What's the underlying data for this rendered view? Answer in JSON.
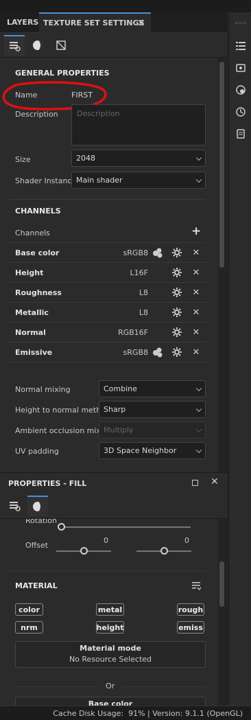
{
  "tabs": {
    "layers": "LAYERS",
    "texture_set_settings": "TEXTURE SET SETTINGS"
  },
  "general": {
    "title": "GENERAL PROPERTIES",
    "name_label": "Name",
    "name_value": "FIRST",
    "description_label": "Description",
    "description_placeholder": "Description",
    "size_label": "Size",
    "size_value": "2048",
    "shader_label": "Shader Instance",
    "shader_value": "Main shader"
  },
  "channels": {
    "title": "CHANNELS",
    "header_label": "Channels",
    "add_icon": "plus-icon",
    "items": [
      {
        "name": "Base color",
        "format": "sRGB8",
        "dither": true
      },
      {
        "name": "Height",
        "format": "L16F",
        "dither": false
      },
      {
        "name": "Roughness",
        "format": "L8",
        "dither": false
      },
      {
        "name": "Metallic",
        "format": "L8",
        "dither": false
      },
      {
        "name": "Normal",
        "format": "RGB16F",
        "dither": false
      },
      {
        "name": "Emissive",
        "format": "sRGB8",
        "dither": true
      }
    ]
  },
  "mixing": {
    "normal_label": "Normal mixing",
    "normal_value": "Combine",
    "height_label": "Height to normal method",
    "height_value": "Sharp",
    "ao_label": "Ambient occlusion mixing",
    "ao_value": "Multiply",
    "uv_label": "UV padding",
    "uv_value": "3D Space Neighbor"
  },
  "properties": {
    "title": "PROPERTIES - FILL",
    "rotation_label": "Rotation",
    "offset_label": "Offset",
    "offset_x": "0",
    "offset_y": "0",
    "material_title": "MATERIAL",
    "chips": [
      "color",
      "metal",
      "rough",
      "nrm",
      "height",
      "emiss"
    ],
    "material_mode_title": "Material mode",
    "material_mode_value": "No Resource Selected",
    "or_label": "Or",
    "base_color_label": "Base color"
  },
  "status": {
    "text": "Cache Disk Usage:  91% | Version: 9.1.1 (OpenGL)"
  },
  "colors": {
    "accent": "#4a90d9",
    "annotation": "#e01010"
  }
}
